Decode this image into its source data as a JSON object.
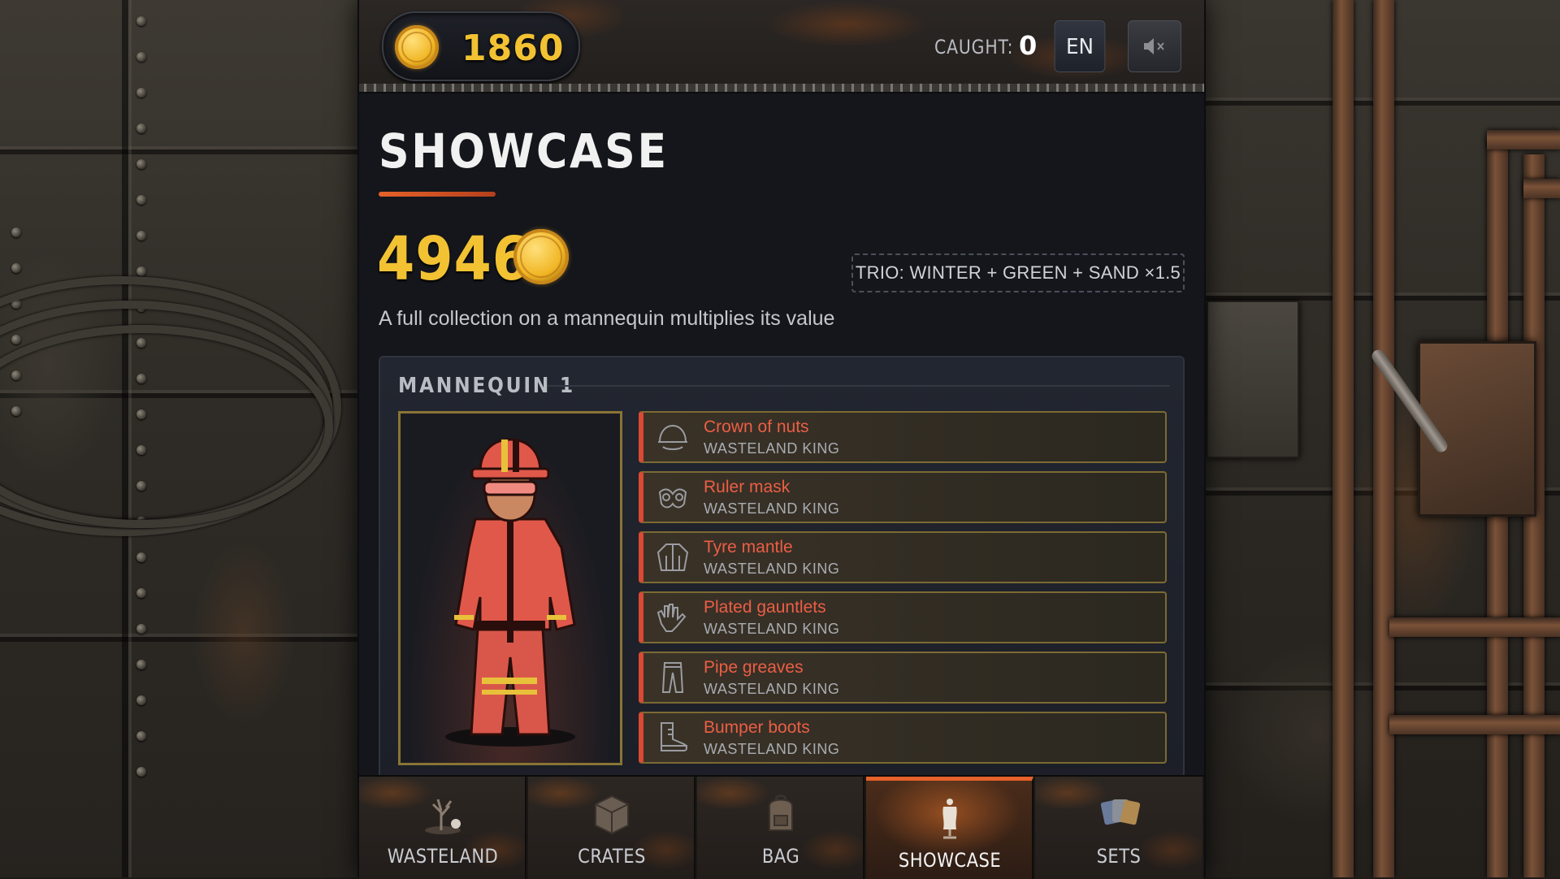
{
  "header": {
    "coins": "1860",
    "caught_label": "CAUGHT:",
    "caught_value": "0",
    "language": "EN",
    "sound_icon": "speaker-muted-icon"
  },
  "page": {
    "title": "SHOWCASE",
    "total_value": "4946",
    "bonus_badge": "TRIO: WINTER + GREEN + SAND ×1.5",
    "description": "A full collection on a mannequin multiplies its value"
  },
  "mannequin": {
    "title": "MANNEQUIN 1",
    "figure_color": "#e0584a",
    "slots": [
      {
        "name": "Crown of nuts",
        "set": "WASTELAND KING",
        "icon": "helmet-icon"
      },
      {
        "name": "Ruler mask",
        "set": "WASTELAND KING",
        "icon": "mask-icon"
      },
      {
        "name": "Tyre mantle",
        "set": "WASTELAND KING",
        "icon": "jacket-icon"
      },
      {
        "name": "Plated gauntlets",
        "set": "WASTELAND KING",
        "icon": "gloves-icon"
      },
      {
        "name": "Pipe greaves",
        "set": "WASTELAND KING",
        "icon": "pants-icon"
      },
      {
        "name": "Bumper boots",
        "set": "WASTELAND KING",
        "icon": "boots-icon"
      }
    ]
  },
  "nav": {
    "tabs": [
      {
        "label": "WASTELAND",
        "icon": "dead-tree-icon"
      },
      {
        "label": "CRATES",
        "icon": "crate-icon"
      },
      {
        "label": "BAG",
        "icon": "backpack-icon"
      },
      {
        "label": "SHOWCASE",
        "icon": "mannequin-icon",
        "active": true
      },
      {
        "label": "SETS",
        "icon": "cards-icon"
      }
    ]
  },
  "colors": {
    "accent": "#e6622a",
    "gold": "#f2c233",
    "item_name": "#ec5e45"
  }
}
